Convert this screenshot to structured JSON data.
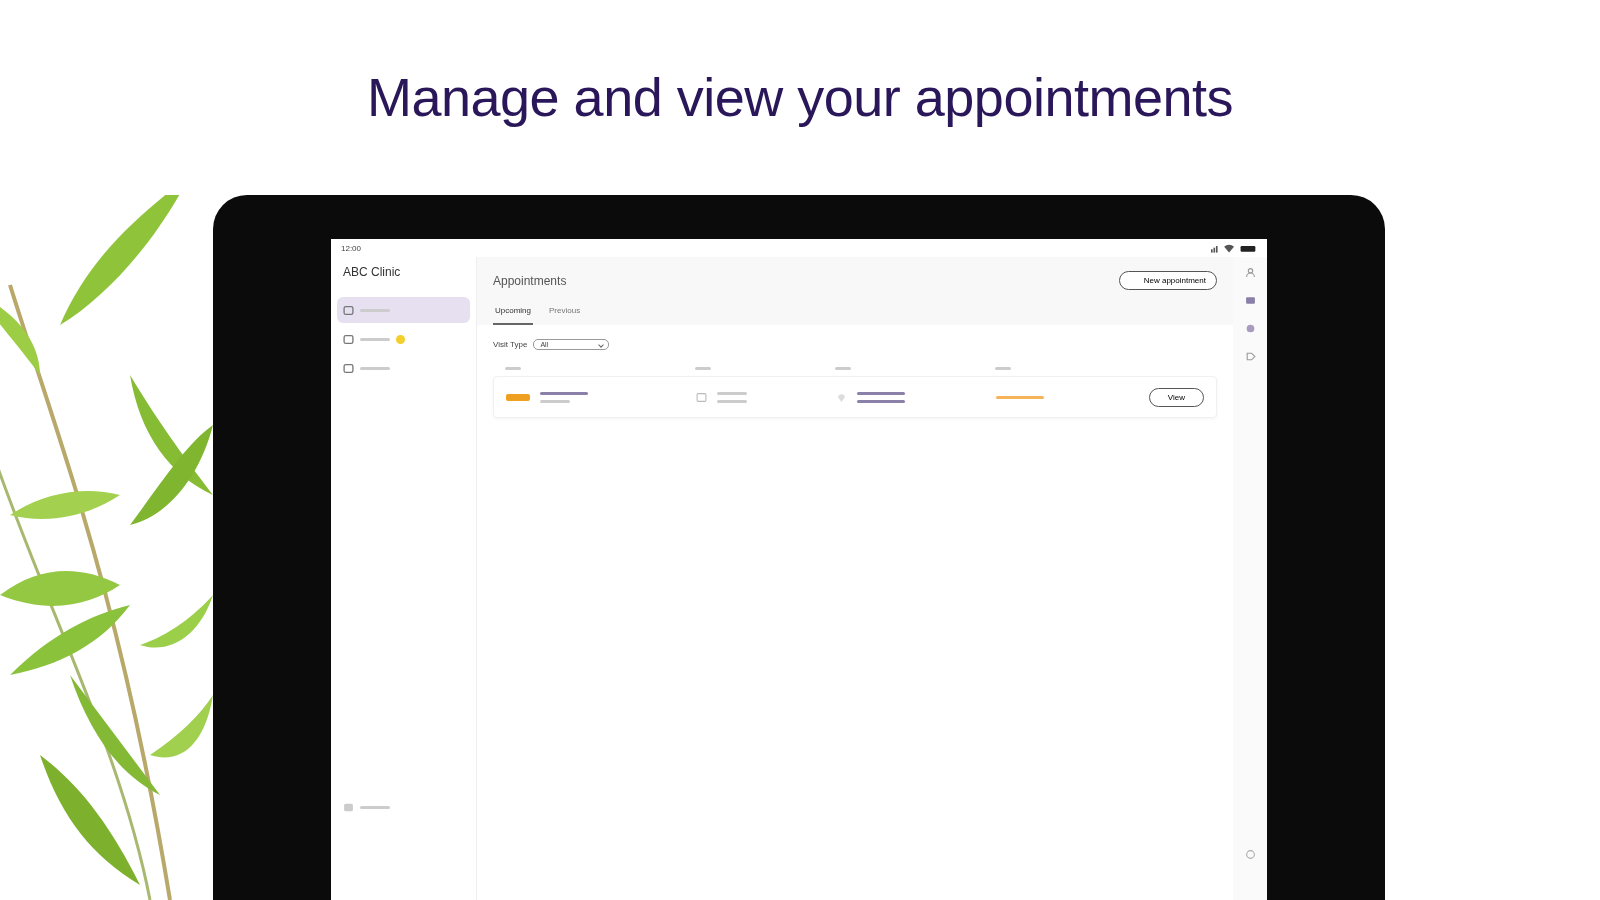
{
  "headline": "Manage and view your appointments",
  "status_bar": {
    "time": "12:00"
  },
  "app": {
    "title": "ABC Clinic"
  },
  "sidebar": {
    "items": [
      {
        "selected": true,
        "badge": false
      },
      {
        "selected": false,
        "badge": true
      },
      {
        "selected": false,
        "badge": false
      }
    ]
  },
  "page": {
    "title": "Appointments",
    "new_button": "New appointment"
  },
  "tabs": [
    {
      "label": "Upcoming",
      "selected": true
    },
    {
      "label": "Previous",
      "selected": false
    }
  ],
  "filter": {
    "label": "Visit Type",
    "value": "All"
  },
  "rows": [
    {
      "action": "View"
    }
  ]
}
